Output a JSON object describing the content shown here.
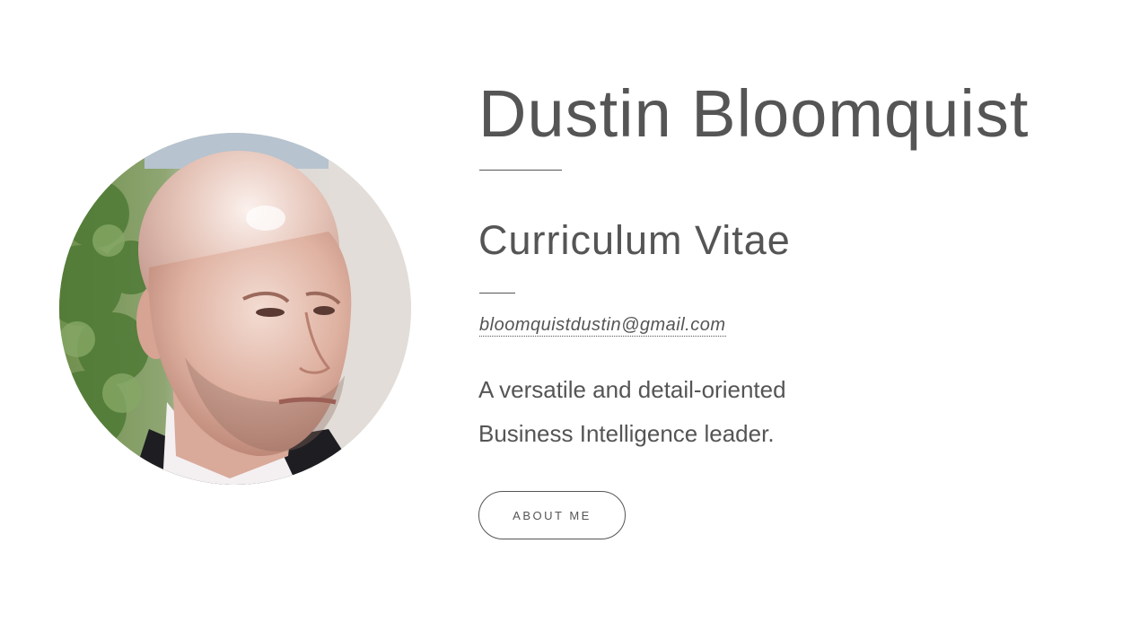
{
  "profile": {
    "name": "Dustin Bloomquist",
    "subtitle": "Curriculum Vitae",
    "email": "bloomquistdustin@gmail.com",
    "tagline_line1": "A versatile and detail-oriented",
    "tagline_line2": "Business Intelligence leader.",
    "about_button_label": "ABOUT ME",
    "portrait_icon": "profile-photo"
  },
  "colors": {
    "text": "#555555",
    "background": "#ffffff"
  }
}
